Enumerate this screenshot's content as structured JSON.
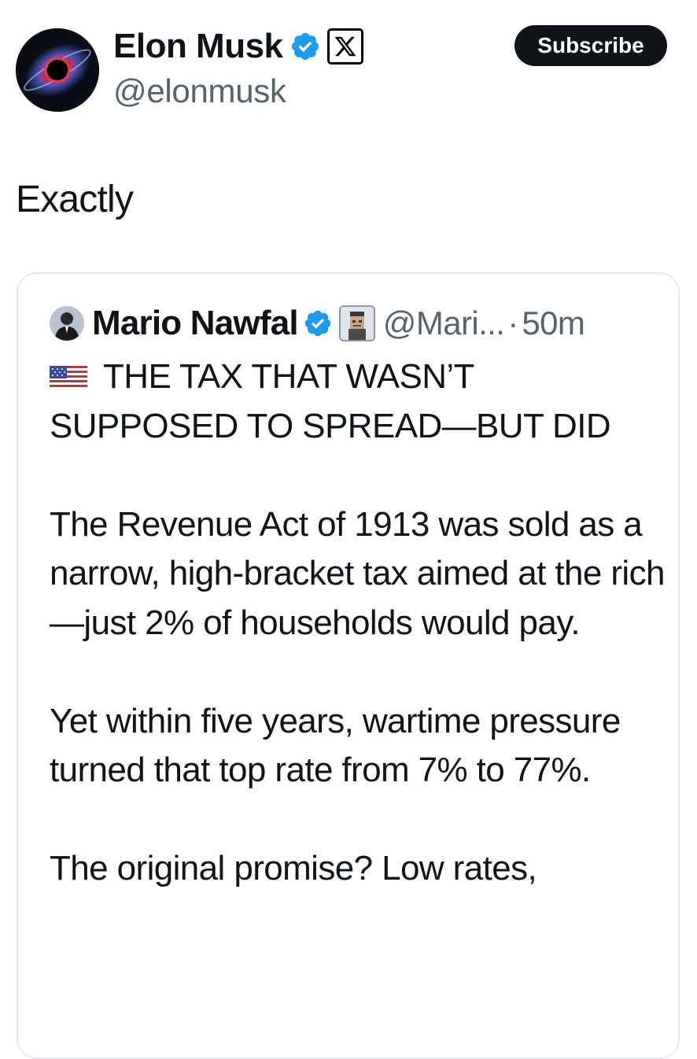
{
  "author": {
    "display_name": "Elon Musk",
    "handle": "@elonmusk",
    "verified_icon": "verified-badge-icon",
    "affiliation_icon": "x-logo-icon"
  },
  "subscribe_label": "Subscribe",
  "tweet_text": "Exactly",
  "quoted_tweet": {
    "display_name": "Mario Nawfal",
    "handle": "@Mari...",
    "separator": "·",
    "time": "50m",
    "headline_emoji": "us-flag-icon",
    "headline_line1": "THE TAX THAT WASN’T",
    "headline_line2": "SUPPOSED TO SPREAD—BUT DID",
    "paragraph1": "The Revenue Act of 1913 was sold as a narrow, high-bracket tax aimed at the rich—just 2% of households would pay.",
    "paragraph2": "Yet within five years, wartime pressure turned that top rate from 7% to 77%.",
    "paragraph3": "The original promise? Low rates,"
  },
  "colors": {
    "text_primary": "#0f1419",
    "text_secondary": "#536471",
    "verified_blue": "#1d9bf0",
    "button_bg": "#0f1419",
    "border": "#e6e9ec"
  }
}
